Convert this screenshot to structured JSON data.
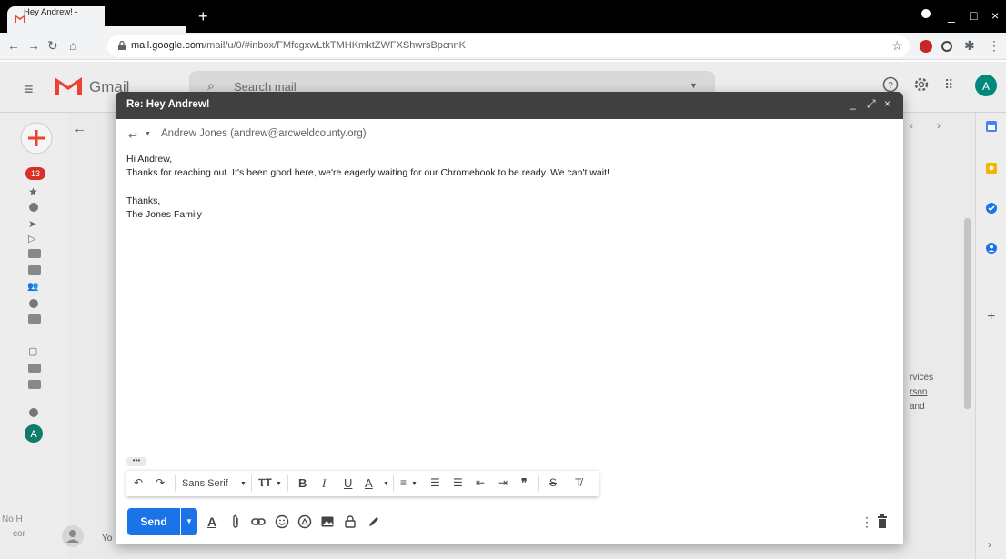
{
  "browser": {
    "tab_title": "Hey Andrew! -",
    "new_tab_label": "+",
    "url_domain": "mail.google.com",
    "url_path": "/mail/u/0/#inbox/FMfcgxwLtkTMHKmktZWFXShwrsBpcnnK",
    "window_controls": [
      "_",
      "□",
      "×"
    ]
  },
  "gmail": {
    "app_name": "Gmail",
    "search_placeholder": "Search mail",
    "avatar_letter": "A",
    "unread_badge": "13",
    "bg_snippets": [
      "rvices",
      "rson",
      "and"
    ],
    "hangouts_label": "No H",
    "hangouts_sub": "cor",
    "bottom_letter": "Yo"
  },
  "compose": {
    "title": "Re: Hey Andrew!",
    "header_controls": [
      "_",
      "⤢",
      "×"
    ],
    "recipient": "Andrew Jones (andrew@arcweldcounty.org)",
    "body_lines": [
      "Hi Andrew,",
      "Thanks for reaching out. It's been good here, we're eagerly waiting for our Chromebook to be ready. We can't wait!",
      "",
      "Thanks,",
      "The Jones Family"
    ],
    "ellipsis": "•••",
    "format_bar": {
      "font": "Sans Serif",
      "bold": "B",
      "italic": "I",
      "underline": "U",
      "text_color": "A"
    },
    "send_label": "Send",
    "formatting_toggle": "A"
  },
  "colors": {
    "send_blue": "#1a73e8",
    "compose_header": "#404040",
    "gmail_red": "#ea4335"
  }
}
